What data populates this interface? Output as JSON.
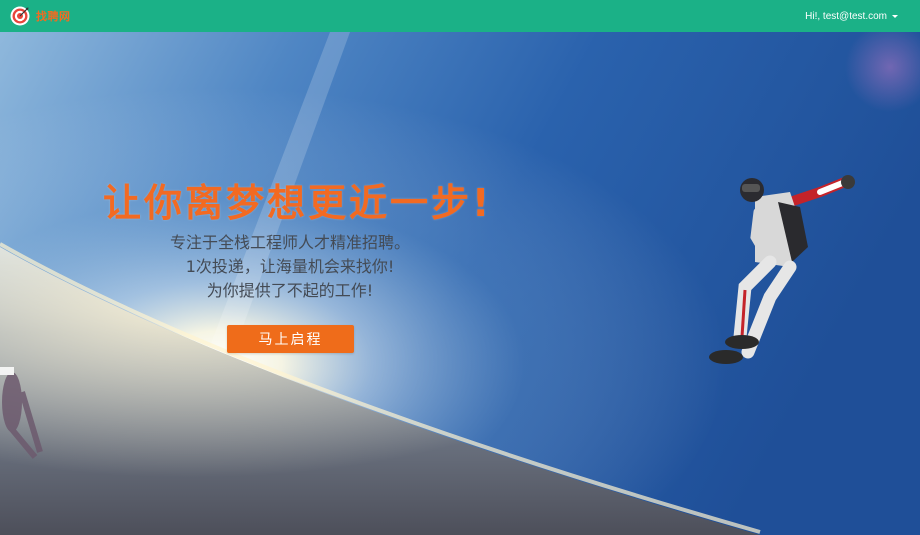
{
  "navbar": {
    "brand_name": "找聘网",
    "user_greeting": "Hi!, test@test.com",
    "bg_color": "#1bb187",
    "brand_color": "#f36b21"
  },
  "hero": {
    "title": "让你离梦想更近一步!",
    "subtitle_lines": [
      "专注于全栈工程师人才精准招聘。",
      "1次投递，让海量机会来找你!",
      "为你提供了不起的工作!"
    ],
    "cta_label": "马上启程",
    "accent_color": "#f26a22"
  },
  "icons": {
    "logo": "target-logo-icon",
    "dropdown": "caret-down-icon"
  }
}
